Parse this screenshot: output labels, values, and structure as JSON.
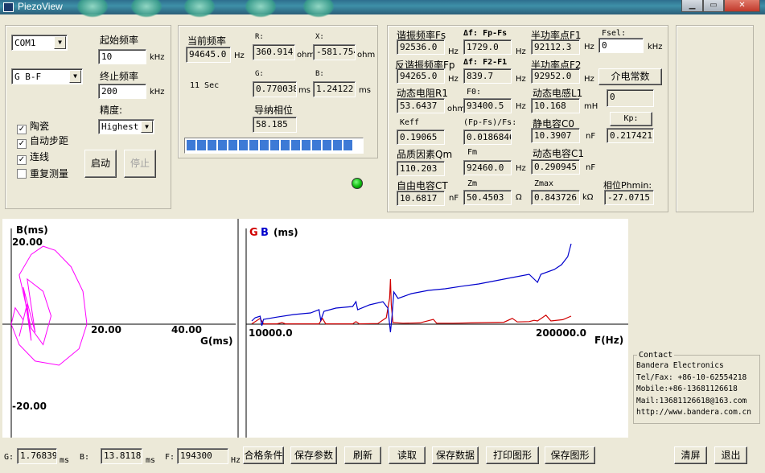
{
  "window": {
    "title": "PiezoView",
    "buttons": [
      "▁",
      "▭",
      "✕"
    ]
  },
  "controls": {
    "port": "COM1",
    "mode": "G B-F",
    "start_freq_label": "起始频率",
    "start_freq": "10",
    "start_freq_unit": "kHz",
    "end_freq_label": "终止频率",
    "end_freq": "200",
    "end_freq_unit": "kHz",
    "precision_label": "精度:",
    "precision": "Highest",
    "checkboxes": [
      {
        "label": "陶瓷",
        "checked": true
      },
      {
        "label": "自动步距",
        "checked": true
      },
      {
        "label": "连线",
        "checked": true
      },
      {
        "label": "重复测量",
        "checked": false
      }
    ],
    "start_button": "启动",
    "stop_button": "停止"
  },
  "current": {
    "freq_label": "当前频率",
    "freq": "94645.0",
    "freq_unit": "Hz",
    "r_label": "R:",
    "r": "360.914",
    "r_unit": "ohm",
    "x_label": "X:",
    "x": "-581.754",
    "x_unit": "ohm",
    "elapsed": "11 Sec",
    "g_label": "G:",
    "g": "0.770038",
    "g_unit": "ms",
    "b_label": "B:",
    "b": "1.24122",
    "b_unit": "ms",
    "phase_label": "导纳相位",
    "phase": "58.185",
    "progress": 1.0
  },
  "params": {
    "fs_label": "谐振频率Fs",
    "fs": "92536.0",
    "fs_unit": "Hz",
    "dfpfs_label": "Δf: Fp-Fs",
    "dfpfs": "1729.0",
    "dfpfs_unit": "Hz",
    "f1_label": "半功率点F1",
    "f1": "92112.3",
    "f1_unit": "Hz",
    "fsel_label": "Fsel:",
    "fsel": "0",
    "fsel_unit": "kHz",
    "fp_label": "反谐振频率Fp",
    "fp": "94265.0",
    "fp_unit": "Hz",
    "df21_label": "Δf: F2-F1",
    "df21": "839.7",
    "df21_unit": "Hz",
    "f2_label": "半功率点F2",
    "f2": "92952.0",
    "f2_unit": "Hz",
    "dielectric_button": "介电常数",
    "dielectric": "0",
    "r1_label": "动态电阻R1",
    "r1": "53.6437",
    "r1_unit": "ohm",
    "f0_label": "F0:",
    "f0": "93400.5",
    "f0_unit": "Hz",
    "l1_label": "动态电感L1",
    "l1": "10.168",
    "l1_unit": "mH",
    "kp_button": "Kp:",
    "kp": "0.217421",
    "keff_label": "Keff",
    "keff": "0.19065",
    "fpfs_label": "(Fp-Fs)/Fs:",
    "fpfs": "0.0186846",
    "c0_label": "静电容C0",
    "c0": "10.3907",
    "c0_unit": "nF",
    "qm_label": "品质因素Qm",
    "qm": "110.203",
    "fm_label": "Fm",
    "fm": "92460.0",
    "fm_unit": "Hz",
    "c1_label": "动态电容C1",
    "c1": "0.290945",
    "c1_unit": "nF",
    "ct_label": "自由电容CT",
    "ct": "10.6817",
    "ct_unit": "nF",
    "zm_label": "Zm",
    "zm": "50.4503",
    "zm_unit": "Ω",
    "zmax_label": "Zmax",
    "zmax": "0.843726",
    "zmax_unit": "kΩ",
    "phmin_label": "相位Phmin:",
    "phmin": "-27.0715"
  },
  "contact": {
    "legend": "Contact",
    "lines": [
      "Bandera Electronics",
      "Tel/Fax: +86-10-62554218",
      "Mobile:+86-13681126618",
      "Mail:13681126618@163.com",
      "http://www.bandera.com.cn"
    ]
  },
  "footer": {
    "g_label": "G:",
    "g": "1.76839",
    "g_unit": "ms",
    "b_label": "B:",
    "b": "13.8118",
    "b_unit": "ms",
    "f_label": "F:",
    "f": "194300",
    "f_unit": "Hz",
    "buttons": [
      "合格条件",
      "保存参数",
      "刷新",
      "读取",
      "保存数据",
      "打印图形",
      "保存图形"
    ],
    "clear_button": "清屏",
    "exit_button": "退出"
  },
  "chart_data": [
    {
      "type": "scatter",
      "title": "",
      "ylabel": "B(ms)",
      "xlabel": "G(ms)",
      "x_ticks": [
        "20.00",
        "40.00"
      ],
      "y_ticks": [
        "20.00",
        "-20.00"
      ],
      "xlim": [
        0,
        50
      ],
      "ylim": [
        -20,
        20
      ],
      "series": [
        {
          "color": "#ff00ff",
          "points": [
            [
              0,
              0
            ],
            [
              1,
              4
            ],
            [
              3,
              1
            ],
            [
              2,
              -3
            ],
            [
              4,
              5
            ],
            [
              5,
              -4
            ],
            [
              3,
              9
            ],
            [
              6,
              -2
            ],
            [
              4,
              11
            ],
            [
              8,
              8
            ],
            [
              10,
              2
            ],
            [
              8,
              -5
            ],
            [
              5,
              -1
            ],
            [
              2,
              12
            ],
            [
              5,
              17
            ],
            [
              8,
              19
            ],
            [
              11,
              18
            ],
            [
              15,
              14
            ],
            [
              18,
              8
            ],
            [
              19,
              0
            ],
            [
              17,
              -6
            ],
            [
              12,
              -10
            ],
            [
              6,
              -9
            ],
            [
              2,
              -5
            ],
            [
              0,
              0
            ]
          ]
        }
      ]
    },
    {
      "type": "line",
      "title": "",
      "legend": [
        "G",
        "B"
      ],
      "legend_colors": [
        "#d00000",
        "#0000cc"
      ],
      "unit_label": "(ms)",
      "xlabel": "F(Hz)",
      "x_ticks": [
        "10000.0",
        "200000.0"
      ],
      "xlim": [
        10000,
        200000
      ],
      "series": [
        {
          "name": "G",
          "color": "#d00000",
          "points": [
            [
              10000,
              0.1
            ],
            [
              15000,
              1.8
            ],
            [
              17000,
              0.1
            ],
            [
              25000,
              0.1
            ],
            [
              28000,
              0.5
            ],
            [
              30000,
              0.1
            ],
            [
              50000,
              0.1
            ],
            [
              52000,
              1.8
            ],
            [
              54000,
              0.1
            ],
            [
              70000,
              0.1
            ],
            [
              72000,
              0.8
            ],
            [
              74000,
              0.1
            ],
            [
              85000,
              0.2
            ],
            [
              90000,
              2
            ],
            [
              92000,
              8
            ],
            [
              92500,
              14
            ],
            [
              93000,
              6
            ],
            [
              94000,
              0.5
            ],
            [
              100000,
              0.3
            ],
            [
              110000,
              0.4
            ],
            [
              118000,
              1.5
            ],
            [
              120000,
              0.3
            ],
            [
              130000,
              0.3
            ],
            [
              140000,
              0.4
            ],
            [
              150000,
              0.5
            ],
            [
              160000,
              0.6
            ],
            [
              165000,
              1.8
            ],
            [
              168000,
              0.7
            ],
            [
              175000,
              0.8
            ],
            [
              178000,
              1.2
            ],
            [
              180000,
              1.0
            ],
            [
              185000,
              2.8
            ],
            [
              188000,
              1.0
            ],
            [
              195000,
              1.4
            ],
            [
              200000,
              2.5
            ]
          ]
        },
        {
          "name": "B",
          "color": "#0000cc",
          "points": [
            [
              10000,
              1.0
            ],
            [
              12000,
              2.0
            ],
            [
              15000,
              2.5
            ],
            [
              16000,
              -0.5
            ],
            [
              17000,
              1.5
            ],
            [
              25000,
              2.2
            ],
            [
              35000,
              3.0
            ],
            [
              45000,
              3.5
            ],
            [
              50000,
              4.5
            ],
            [
              51000,
              1.2
            ],
            [
              53000,
              4.0
            ],
            [
              60000,
              5.0
            ],
            [
              70000,
              5.5
            ],
            [
              72000,
              7.0
            ],
            [
              73000,
              4.5
            ],
            [
              80000,
              6.0
            ],
            [
              88000,
              7.0
            ],
            [
              91000,
              5.0
            ],
            [
              92500,
              -2.5
            ],
            [
              93500,
              3.0
            ],
            [
              94500,
              10.0
            ],
            [
              97000,
              8.0
            ],
            [
              105000,
              9.5
            ],
            [
              115000,
              10.5
            ],
            [
              125000,
              11.0
            ],
            [
              135000,
              11.8
            ],
            [
              145000,
              12.5
            ],
            [
              155000,
              13.5
            ],
            [
              165000,
              14.5
            ],
            [
              175000,
              15.5
            ],
            [
              180000,
              13.0
            ],
            [
              182000,
              15.5
            ],
            [
              190000,
              17.0
            ],
            [
              194300,
              18.5
            ],
            [
              198000,
              21.0
            ],
            [
              200000,
              25.0
            ]
          ]
        }
      ]
    }
  ]
}
